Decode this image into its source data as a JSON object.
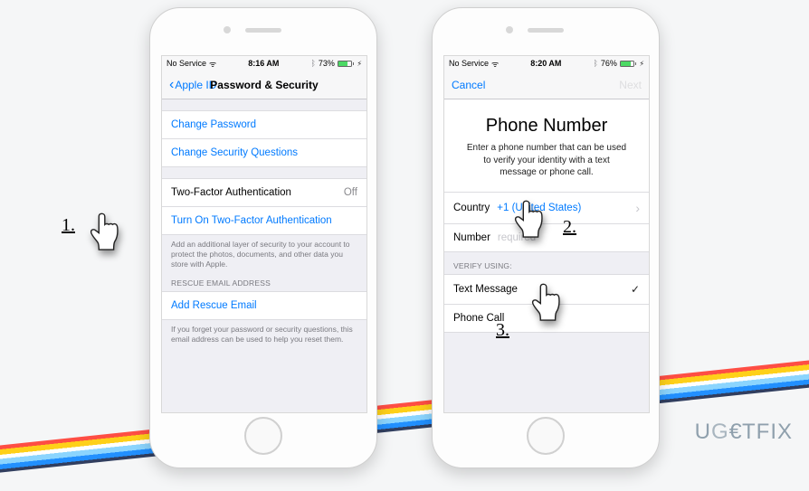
{
  "phone1": {
    "status": {
      "carrier": "No Service",
      "time": "8:16 AM",
      "battery_pct": "73%",
      "battery_fill": 73
    },
    "nav": {
      "back": "Apple ID",
      "title": "Password & Security"
    },
    "change_password": "Change Password",
    "change_questions": "Change Security Questions",
    "tfa_label": "Two-Factor Authentication",
    "tfa_value": "Off",
    "turn_on_tfa": "Turn On Two-Factor Authentication",
    "tfa_footer": "Add an additional layer of security to your account to protect the photos, documents, and other data you store with Apple.",
    "rescue_header": "RESCUE EMAIL ADDRESS",
    "add_rescue": "Add Rescue Email",
    "rescue_footer": "If you forget your password or security questions, this email address can be used to help you reset them."
  },
  "phone2": {
    "status": {
      "carrier": "No Service",
      "time": "8:20 AM",
      "battery_pct": "76%",
      "battery_fill": 76
    },
    "nav": {
      "cancel": "Cancel",
      "next": "Next"
    },
    "title": "Phone Number",
    "subtitle": "Enter a phone number that can be used to verify your identity with a text message or phone call.",
    "country_label": "Country",
    "country_value": "+1 (United States)",
    "number_label": "Number",
    "number_placeholder": "required",
    "verify_header": "VERIFY USING:",
    "text_message": "Text Message",
    "phone_call": "Phone Call"
  },
  "annotations": {
    "step1": "1.",
    "step2": "2.",
    "step3": "3."
  },
  "logo": "UG€TFIX"
}
